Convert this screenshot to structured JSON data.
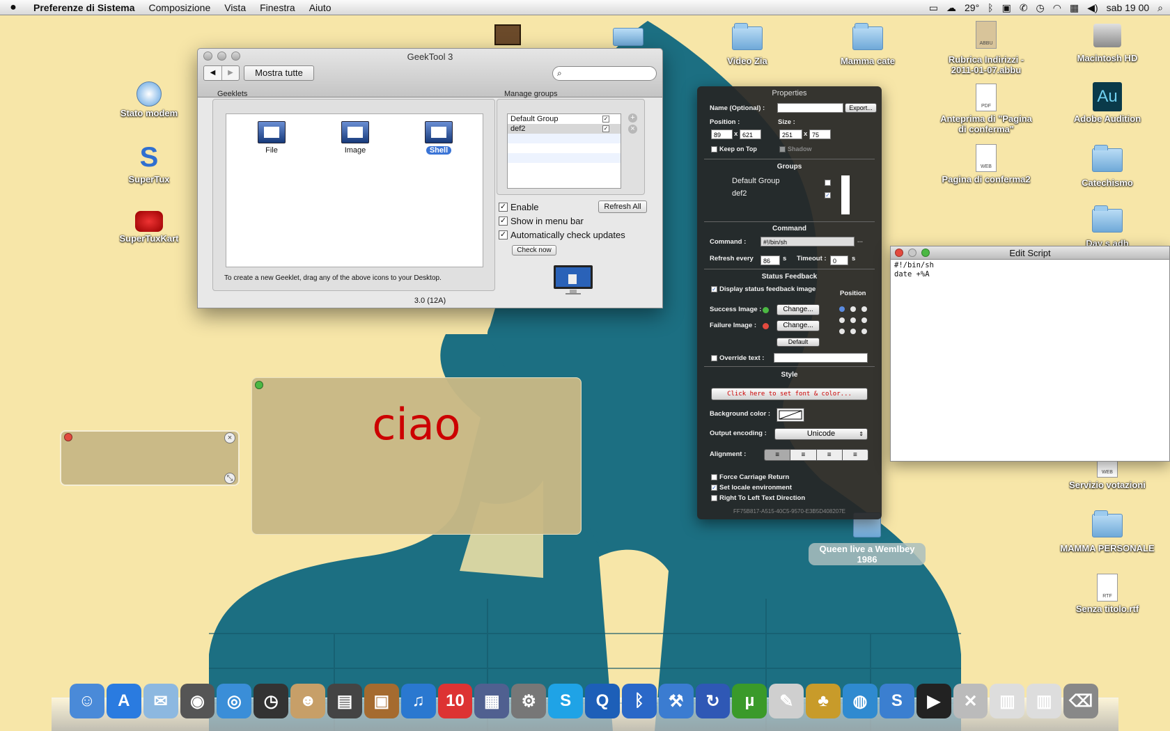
{
  "menubar": {
    "app_name": "Preferenze di Sistema",
    "items": [
      "Composizione",
      "Vista",
      "Finestra",
      "Aiuto"
    ],
    "temperature": "29°",
    "clock": "sab 19 00"
  },
  "desktop_icons": {
    "stato_modem": "Stato modem",
    "supertux": "SuperTux",
    "supertuxkart": "SuperTuxKart",
    "video_zia": "Video Zia",
    "mamma_cate": "Mamma cate",
    "rubrica": "Rubrica Indirizzi - 2011-01-07.abbu",
    "macintosh_hd": "Macintosh HD",
    "anteprima": "Anteprima di \"Pagina di conferma\"",
    "adobe_audition": "Adobe Audition",
    "pagina_conferma2": "Pagina di conferma2",
    "catechismo": "Catechismo",
    "day_partial": "Day s adh",
    "servizio_votazioni": "Servizio votazioni",
    "mamma_personale": "MAMMA PERSONALE",
    "senza_titolo": "Senza titolo.rtf",
    "queen": "Queen live a Wemlbey 1986",
    "doc_type_abbu": "ABBU",
    "doc_type_pdf": "PDF",
    "doc_type_web": "WEB",
    "doc_type_rtf": "RTF",
    "au_glyph": "Au"
  },
  "geektool": {
    "title": "GeekTool 3",
    "show_all": "Mostra tutte",
    "search_placeholder": "",
    "geeklets_label": "Geeklets",
    "geeklets": [
      {
        "label": "File"
      },
      {
        "label": "Image"
      },
      {
        "label": "Shell"
      }
    ],
    "hint": "To create a new Geeklet, drag any of the above icons to your Desktop.",
    "groups_label": "Manage groups",
    "groups": [
      "Default Group",
      "def2"
    ],
    "enable": "Enable",
    "refresh_all": "Refresh All",
    "show_menu_bar": "Show in menu bar",
    "auto_check": "Automatically check updates",
    "check_now": "Check now",
    "version": "3.0 (12A)"
  },
  "properties": {
    "title": "Properties",
    "name_label": "Name (Optional) :",
    "name_value": "",
    "export": "Export...",
    "position_label": "Position :",
    "pos_x": "89",
    "pos_y": "621",
    "x_sep": "x",
    "size_label": "Size :",
    "size_w": "251",
    "size_h": "75",
    "keep_on_top": "Keep on Top",
    "shadow": "Shadow",
    "groups_section": "Groups",
    "groups": [
      "Default Group",
      "def2"
    ],
    "command_section": "Command",
    "command_label": "Command :",
    "command_value": "#!/bin/sh",
    "refresh_label": "Refresh every",
    "refresh_value": "86",
    "refresh_unit": "s",
    "timeout_label": "Timeout :",
    "timeout_value": "0",
    "timeout_unit": "s",
    "feedback_section": "Status Feedback",
    "display_feedback": "Display status feedback image",
    "position_heading": "Position",
    "success_label": "Success Image :",
    "failure_label": "Failure Image :",
    "change": "Change...",
    "default": "Default",
    "override_label": "Override text :",
    "style_section": "Style",
    "font_button": "Click here to set font & color...",
    "bg_color_label": "Background color :",
    "encoding_label": "Output encoding :",
    "encoding_value": "Unicode",
    "alignment_label": "Alignment :",
    "force_cr": "Force Carriage Return",
    "set_locale": "Set locale environment",
    "rtl": "Right To Left Text Direction",
    "uuid": "FF75B817-A515-40C5-9570-E3B5D408207E"
  },
  "edit_script": {
    "title": "Edit Script",
    "code": "#!/bin/sh\ndate +%A"
  },
  "geeklet_ciao": {
    "text": "ciao"
  },
  "dock": {
    "items": [
      {
        "name": "finder",
        "glyph": "☺",
        "color": "#4a8ad8"
      },
      {
        "name": "app-store",
        "glyph": "A",
        "color": "#2a7be0"
      },
      {
        "name": "preview",
        "glyph": "✉",
        "color": "#8db8e0"
      },
      {
        "name": "photo-booth",
        "glyph": "◉",
        "color": "#555"
      },
      {
        "name": "safari",
        "glyph": "◎",
        "color": "#3a8ed8"
      },
      {
        "name": "dashboard",
        "glyph": "◷",
        "color": "#333"
      },
      {
        "name": "iphoto-people",
        "glyph": "☻",
        "color": "#c79f68"
      },
      {
        "name": "printer",
        "glyph": "▤",
        "color": "#444"
      },
      {
        "name": "iphoto",
        "glyph": "▣",
        "color": "#a56b2f"
      },
      {
        "name": "itunes",
        "glyph": "♫",
        "color": "#2a78d0"
      },
      {
        "name": "ical",
        "glyph": "10",
        "color": "#d33"
      },
      {
        "name": "spaces",
        "glyph": "▦",
        "color": "#506090"
      },
      {
        "name": "system-preferences",
        "glyph": "⚙",
        "color": "#777"
      },
      {
        "name": "skype",
        "glyph": "S",
        "color": "#1fa3e6"
      },
      {
        "name": "quicktime",
        "glyph": "Q",
        "color": "#1d5fb8"
      },
      {
        "name": "bluetooth",
        "glyph": "ᛒ",
        "color": "#2a68c8"
      },
      {
        "name": "xcode",
        "glyph": "⚒",
        "color": "#3b7cd1"
      },
      {
        "name": "sync",
        "glyph": "↻",
        "color": "#2f58b5"
      },
      {
        "name": "utorrent",
        "glyph": "µ",
        "color": "#3a9a2a"
      },
      {
        "name": "textedit",
        "glyph": "✎",
        "color": "#cfcfcf"
      },
      {
        "name": "pineapple",
        "glyph": "♣",
        "color": "#c89b2a"
      },
      {
        "name": "globe",
        "glyph": "◍",
        "color": "#2f8ad0"
      },
      {
        "name": "supertux",
        "glyph": "S",
        "color": "#3b7fd0"
      },
      {
        "name": "tv-series",
        "glyph": "▶",
        "color": "#222"
      },
      {
        "name": "applications",
        "glyph": "✕",
        "color": "#bbb"
      },
      {
        "name": "stack-docs",
        "glyph": "▥",
        "color": "#ddd"
      },
      {
        "name": "stack-downloads",
        "glyph": "▥",
        "color": "#ddd"
      },
      {
        "name": "trash",
        "glyph": "⌫",
        "color": "#888"
      }
    ]
  },
  "colors": {
    "wallpaper_bg": "#f7e6a8",
    "silhouette": "#1c6f82",
    "hud_bg": "#262626",
    "ciao_text": "#cc0000",
    "geeklet_bg": "#c8b885",
    "selection_blue": "#3a74d6"
  }
}
